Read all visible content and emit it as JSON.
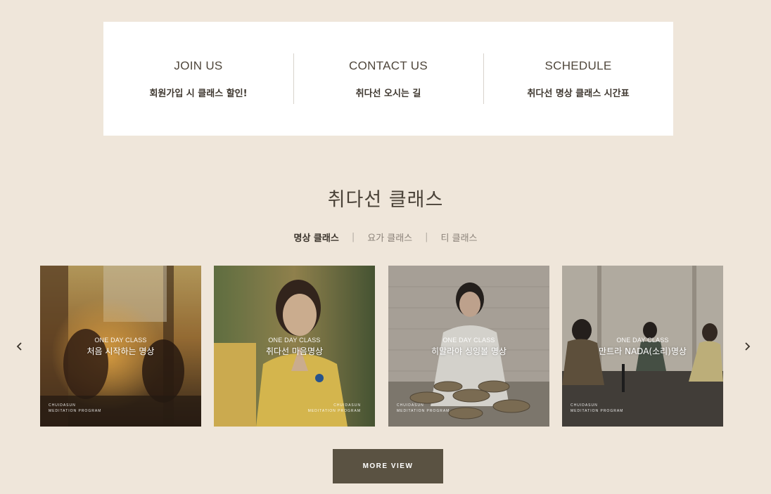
{
  "info": [
    {
      "title": "JOIN US",
      "subtitle": "회원가입 시 클래스 할인!"
    },
    {
      "title": "CONTACT US",
      "subtitle": "취다선 오시는 길"
    },
    {
      "title": "SCHEDULE",
      "subtitle": "취다선 명상 클래스 시간표"
    }
  ],
  "section": {
    "title": "취다선 클래스",
    "tabs": [
      {
        "label": "명상 클래스",
        "active": true
      },
      {
        "label": "요가 클래스",
        "active": false
      },
      {
        "label": "티 클래스",
        "active": false
      }
    ],
    "separator": "|"
  },
  "carousel": {
    "prev_icon": "chevron-left-icon",
    "next_icon": "chevron-right-icon",
    "cards": [
      {
        "eyebrow": "ONE DAY CLASS",
        "title": "처음 시작하는 명상",
        "brand_line1": "CHUIDASUN",
        "brand_line2": "MEDITATION PROGRAM"
      },
      {
        "eyebrow": "ONE DAY CLASS",
        "title": "취다선 마음명상",
        "brand_line1": "CHUIDASUN",
        "brand_line2": "MEDITATION PROGRAM"
      },
      {
        "eyebrow": "ONE DAY CLASS",
        "title": "히말라야 싱잉볼 명상",
        "brand_line1": "CHUIDASUN",
        "brand_line2": "MEDITATION PROGRAM"
      },
      {
        "eyebrow": "ONE DAY CLASS",
        "title": "만트라 NADA(소리)명상",
        "brand_line1": "CHUIDASUN",
        "brand_line2": "MEDITATION PROGRAM"
      }
    ]
  },
  "more_button": {
    "label": "MORE VIEW"
  },
  "colors": {
    "background": "#efe6da",
    "button": "#5a5242",
    "text_dark": "#4a4238"
  }
}
